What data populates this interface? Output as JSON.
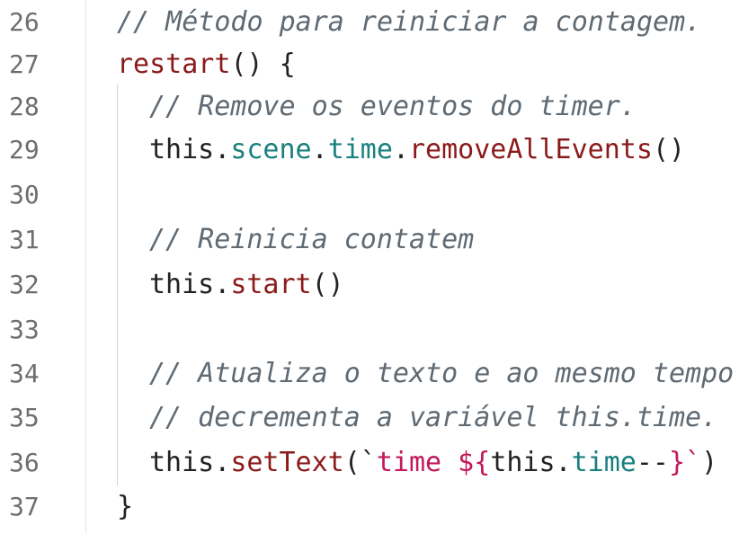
{
  "lines": [
    {
      "no": "26",
      "comment": "// Método para reinicia r a contagem."
    },
    {
      "no": "27"
    },
    {
      "no": "28",
      "comment": "// Remove os eventos do timer."
    },
    {
      "no": "29"
    },
    {
      "no": "30"
    },
    {
      "no": "31",
      "comment": "// Reinicia contatem"
    },
    {
      "no": "32"
    },
    {
      "no": "33"
    },
    {
      "no": "34",
      "comment": "// Atualiza o texto e ao mesmo tempo"
    },
    {
      "no": "35",
      "comment": "// decrementa a variável this.time."
    },
    {
      "no": "36"
    },
    {
      "no": "37"
    }
  ],
  "tokens": {
    "restart": "restart",
    "parens_open_brace": "() {",
    "this": "this",
    "dot": ".",
    "scene": "scene",
    "time": "time",
    "removeAllEvents": "removeAllEvents",
    "parens": "()",
    "start": "start",
    "setText": "setText",
    "open_paren_tick": "(`",
    "tpl_text": "time ${",
    "this_dot": "this.",
    "time_prop": "time",
    "decrement": "--",
    "tpl_close": "}`",
    "close_paren": ")",
    "close_brace": "}"
  }
}
